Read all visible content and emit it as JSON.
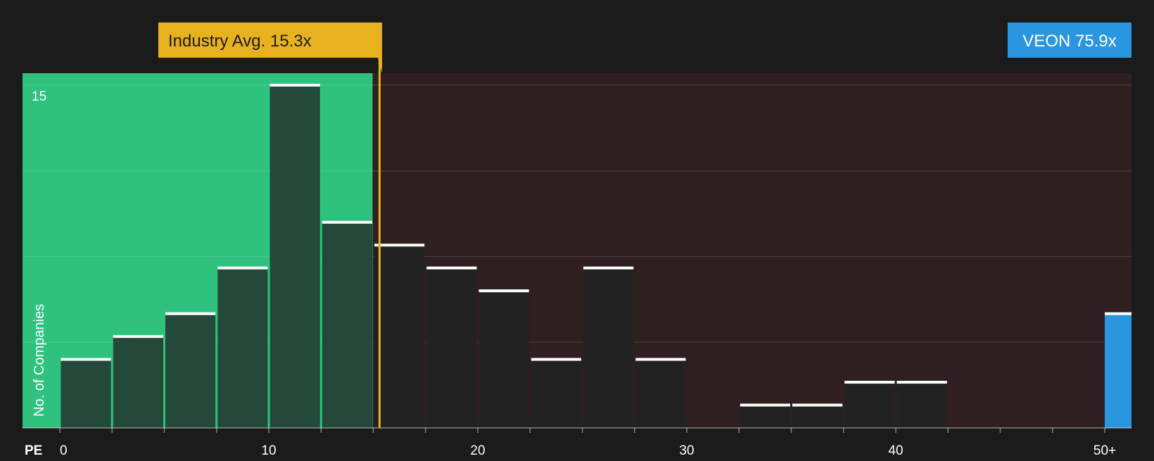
{
  "chart_data": {
    "type": "bar",
    "xlabel": "PE",
    "ylabel": "No. of Companies",
    "x_tick_labels": [
      "0",
      "10",
      "20",
      "30",
      "40",
      "50+"
    ],
    "y_tick_labels": [
      "15"
    ],
    "ylim": [
      0,
      15.5
    ],
    "grid": true,
    "bins": [
      {
        "from": 0,
        "to": 2.5,
        "value": 3
      },
      {
        "from": 2.5,
        "to": 5,
        "value": 4
      },
      {
        "from": 5,
        "to": 7.5,
        "value": 5
      },
      {
        "from": 7.5,
        "to": 10,
        "value": 7
      },
      {
        "from": 10,
        "to": 12.5,
        "value": 15
      },
      {
        "from": 12.5,
        "to": 15,
        "value": 9
      },
      {
        "from": 15,
        "to": 17.5,
        "value": 8
      },
      {
        "from": 17.5,
        "to": 20,
        "value": 7
      },
      {
        "from": 20,
        "to": 22.5,
        "value": 6
      },
      {
        "from": 22.5,
        "to": 25,
        "value": 3
      },
      {
        "from": 25,
        "to": 27.5,
        "value": 7
      },
      {
        "from": 27.5,
        "to": 30,
        "value": 3
      },
      {
        "from": 30,
        "to": 32.5,
        "value": 0
      },
      {
        "from": 32.5,
        "to": 35,
        "value": 1
      },
      {
        "from": 35,
        "to": 37.5,
        "value": 1
      },
      {
        "from": 37.5,
        "to": 40,
        "value": 2
      },
      {
        "from": 40,
        "to": 42.5,
        "value": 2
      },
      {
        "from": 42.5,
        "to": 45,
        "value": 0
      },
      {
        "from": 45,
        "to": 47.5,
        "value": 0
      },
      {
        "from": 47.5,
        "to": 50,
        "value": 0
      }
    ],
    "highlight_bar": {
      "label": "50+",
      "value": 5
    },
    "industry_avg": {
      "label": "Industry Avg. 15.3x",
      "value": 15.3
    },
    "company": {
      "label": "VEON 75.9x",
      "value": 75.9
    },
    "colors": {
      "below_avg_region": "#2ec27e",
      "above_avg_region": "#2f1f20",
      "bar_in_green": "#24493a",
      "bar_in_red": "#232222",
      "bar_top": "#ffffff",
      "avg_line": "#e8b21f",
      "company_bar": "#2a96e0",
      "background": "#1b1b1b"
    }
  }
}
